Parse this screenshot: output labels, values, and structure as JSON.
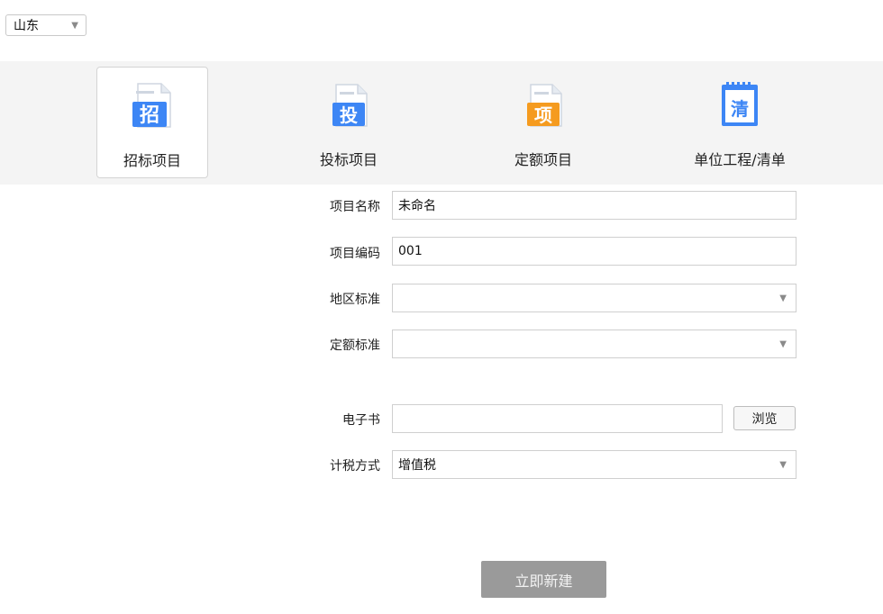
{
  "region": {
    "value": "山东"
  },
  "project_types": [
    {
      "label": "招标项目",
      "icon": "zhao-doc-icon",
      "glyph": "招",
      "active": true
    },
    {
      "label": "投标项目",
      "icon": "tou-doc-icon",
      "glyph": "投",
      "active": false
    },
    {
      "label": "定额项目",
      "icon": "xiang-doc-icon",
      "glyph": "项",
      "active": false
    },
    {
      "label": "单位工程/清单",
      "icon": "qing-notepad-icon",
      "glyph": "清",
      "active": false
    }
  ],
  "form": {
    "project_name": {
      "label": "项目名称",
      "value": "未命名"
    },
    "project_code": {
      "label": "项目编码",
      "value": "001"
    },
    "region_standard": {
      "label": "地区标准",
      "value": ""
    },
    "quota_standard": {
      "label": "定额标准",
      "value": ""
    },
    "ebook": {
      "label": "电子书",
      "value": "",
      "browse_label": "浏览"
    },
    "tax_method": {
      "label": "计税方式",
      "value": "增值税"
    }
  },
  "create_button": {
    "label": "立即新建"
  },
  "colors": {
    "blue": "#3d86f5",
    "orange": "#f59b1f",
    "band_bg": "#f4f4f4",
    "button_disabled": "#9a9a9a"
  }
}
